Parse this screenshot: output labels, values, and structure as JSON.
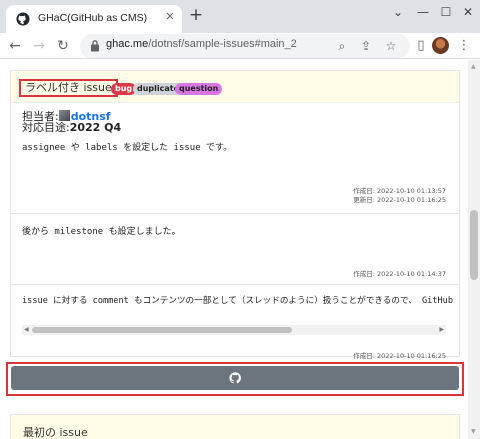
{
  "browser": {
    "tab_title": "GHaC(GitHub as CMS)",
    "url_host": "ghac.me",
    "url_path": "/dotnsf/sample-issues#main_2"
  },
  "issue": {
    "title": "ラベル付き issue",
    "labels": [
      {
        "name": "bug",
        "color": "#d73a4a"
      },
      {
        "name": "duplicate",
        "color": "#cfd3d7"
      },
      {
        "name": "question",
        "color": "#d876e3"
      }
    ],
    "assignee_label": "担当者:",
    "assignee": "dotnsf",
    "milestone_label": "対応目途:",
    "milestone": "2022 Q4",
    "body": "assignee や labels を設定した issue です。",
    "created": "作成日: 2022-10-10 01:13:57",
    "updated": "更新日: 2022-10-10 01:16:25"
  },
  "comments": [
    {
      "body": "後から milestone も設定しました。",
      "created": "作成日: 2022-10-10 01:14:37"
    },
    {
      "body": "issue に対する comment もコンテンツの一部として（スレッドのように）扱うことができるので、 GitHub",
      "created": "作成日: 2022-10-10 01:16:25"
    }
  ],
  "next_issue": {
    "title": "最初の issue"
  },
  "colors": {
    "accent_red": "#d9343a",
    "button_gray": "#6c757d",
    "header_bg": "#fffbe6"
  }
}
